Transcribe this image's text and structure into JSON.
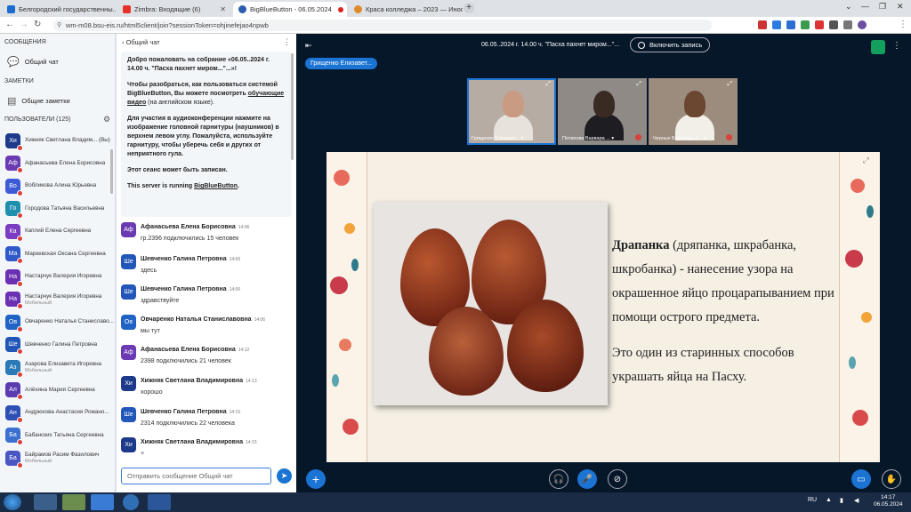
{
  "browser": {
    "tabs": [
      {
        "title": "Белгородский государственны...",
        "color": "#1b6bd1"
      },
      {
        "title": "Zimbra: Входящие (6)",
        "color": "#e6332a"
      },
      {
        "title": "BigBlueButton - 06.05.2024",
        "color": "#2a5db0"
      },
      {
        "title": "Краса колледжа – 2023 — Инос...",
        "color": "#e08a2c"
      }
    ],
    "url": "wm-m08.bsu-eis.ru/html5client/join?sessionToken=ohjinefejao4npwb"
  },
  "sidebar": {
    "messages_title": "СООБЩЕНИЯ",
    "public_chat": "Общий чат",
    "notes_title": "ЗАМЕТКИ",
    "shared_notes": "Общие заметки",
    "users_title": "ПОЛЬЗОВАТЕЛИ (125)",
    "users": [
      {
        "initials": "Хи",
        "name": "Хижняк Светлана Владим... (Вы)",
        "sub": "",
        "color": "#1d3a8a"
      },
      {
        "initials": "Аф",
        "name": "Афанасьева Елена Борисовна",
        "sub": "",
        "color": "#6a3ab2"
      },
      {
        "initials": "Во",
        "name": "Вобликова Алина Юрьевна",
        "sub": "",
        "color": "#3d5bd6"
      },
      {
        "initials": "Го",
        "name": "Городова Татьяна Васильевна",
        "sub": "",
        "color": "#1f8fb0"
      },
      {
        "initials": "Ка",
        "name": "Каплий Елена Сергеевна",
        "sub": "",
        "color": "#7b3cc4"
      },
      {
        "initials": "Ма",
        "name": "Маркевская Оксана Сергеевна",
        "sub": "",
        "color": "#2f58c9"
      },
      {
        "initials": "На",
        "name": "Настарчук Валерия Игоревна",
        "sub": "",
        "color": "#6a2fb2"
      },
      {
        "initials": "На",
        "name": "Настарчук Валерия Игоревна",
        "sub": "Мобильный",
        "color": "#6a2fb2"
      },
      {
        "initials": "Ов",
        "name": "Овчаренко Наталья Станиславо...",
        "sub": "",
        "color": "#2063c4"
      },
      {
        "initials": "Ше",
        "name": "Шевченко Галина Петровна",
        "sub": "",
        "color": "#2256b8"
      },
      {
        "initials": "Аз",
        "name": "Азарова Елизавета Игоревна",
        "sub": "Мобильный",
        "color": "#2a7ab8"
      },
      {
        "initials": "Ал",
        "name": "Алёхина Мария Сергеевна",
        "sub": "",
        "color": "#5a3cb0"
      },
      {
        "initials": "Ан",
        "name": "Андрюхова Анастасия Романо...",
        "sub": "",
        "color": "#2d4fb5"
      },
      {
        "initials": "Ба",
        "name": "Бабанских Татьяна Сергеевна",
        "sub": "",
        "color": "#3b6fd0"
      },
      {
        "initials": "Ба",
        "name": "Байрамов Расим Фазилович",
        "sub": "Мобильный",
        "color": "#4a56c2"
      }
    ]
  },
  "chat": {
    "header": "Общий чат",
    "welcome_1": "Добро пожаловать на собрание «06.05..2024 г. 14.00 ч. \"Пасха пахнет миром...\"...»!",
    "welcome_2a": "Чтобы разобраться, как пользоваться системой BigBlueButton, Вы можете посмотреть",
    "welcome_2link": "обучающие видео",
    "welcome_2b": "(на английском языке).",
    "welcome_3a": "Для участия в аудиоконференции нажмите на изображение головной гарнитуры (наушников) в верхнем левом углу.",
    "welcome_3b": "Пожалуйста, используйте гарнитуру, чтобы уберечь себя и других от неприятного гула.",
    "welcome_4": "Этот сеанс может быть записан.",
    "welcome_5a": "This server is running",
    "welcome_5link": "BigBlueButton",
    "messages": [
      {
        "initials": "Аф",
        "name": "Афанасьева Елена Борисовна",
        "time": "14:06",
        "text": "гр.2396 подключились 15 человек",
        "color": "#6a3ab2"
      },
      {
        "initials": "Ше",
        "name": "Шевченко Галина Петровна",
        "time": "14:06",
        "text": "здесь",
        "color": "#2256b8"
      },
      {
        "initials": "Ше",
        "name": "Шевченко Галина Петровна",
        "time": "14:06",
        "text": "здравствуйте",
        "color": "#2256b8"
      },
      {
        "initials": "Ов",
        "name": "Овчаренко Наталья Станиславовна",
        "time": "14:06",
        "text": "мы тут",
        "color": "#2063c4"
      },
      {
        "initials": "Аф",
        "name": "Афанасьева Елена Борисовна",
        "time": "14:12",
        "text": "2398 подключились 21 человек",
        "color": "#6a3ab2"
      },
      {
        "initials": "Хи",
        "name": "Хижняк Светлана Владимировна",
        "time": "14:13",
        "text": "хорошо",
        "color": "#1d3a8a"
      },
      {
        "initials": "Ше",
        "name": "Шевченко Галина Петровна",
        "time": "14:15",
        "text": "2314 подключились 22 человека",
        "color": "#2256b8"
      },
      {
        "initials": "Хи",
        "name": "Хижняк Светлана Владимировна",
        "time": "14:15",
        "text": "+",
        "color": "#1d3a8a"
      }
    ],
    "input_placeholder": "Отправить сообщение Общий чат"
  },
  "meeting": {
    "title": "06.05..2024 г. 14.00 ч. \"Пасха пахнет миром...\"...",
    "record_label": "Включить запись",
    "presenter_pill": "Грищенко Елизавет...",
    "cameras": [
      {
        "label": "Грищенко Елизавет... ▾"
      },
      {
        "label": "Потапова Варвара ... ▾"
      },
      {
        "label": "Черных Вероника А... ▾"
      }
    ],
    "slide": {
      "term": "Драпанка",
      "text_1": " (дряпанка, шкрабанка, шкробанка) - нанесение узора на окрашенное яйцо процарапыванием при помощи острого предмета.",
      "text_2": "Это один из старинных способов украшать яйца на Пасху."
    }
  },
  "taskbar": {
    "lang": "RU",
    "time": "14:17",
    "date": "06.05.2024"
  }
}
